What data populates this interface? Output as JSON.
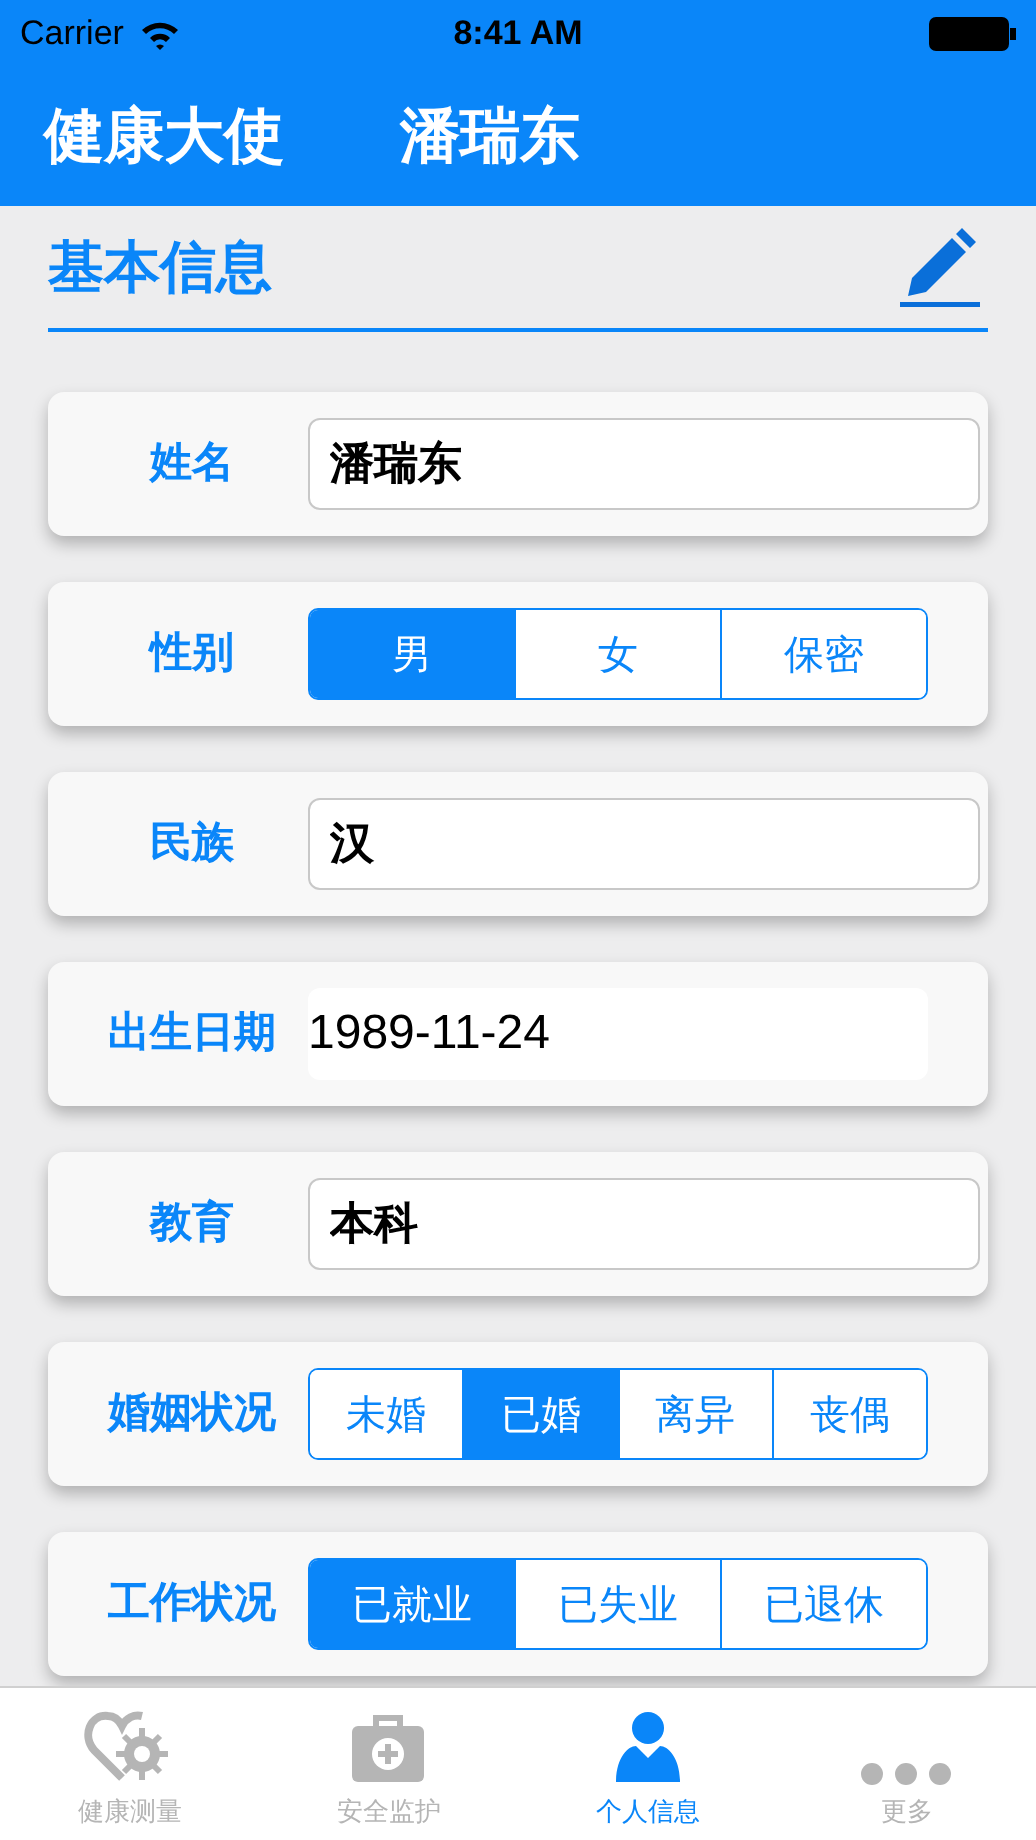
{
  "status_bar": {
    "carrier": "Carrier",
    "time": "8:41 AM"
  },
  "header": {
    "title": "健康大使",
    "name": "潘瑞东"
  },
  "section": {
    "title": "基本信息"
  },
  "fields": [
    {
      "kind": "text",
      "label": "姓名",
      "value": "潘瑞东"
    },
    {
      "kind": "segmented",
      "label": "性别",
      "options": [
        {
          "label": "男",
          "selected": true
        },
        {
          "label": "女",
          "selected": false
        },
        {
          "label": "保密",
          "selected": false
        }
      ]
    },
    {
      "kind": "text",
      "label": "民族",
      "value": "汉"
    },
    {
      "kind": "date",
      "label": "出生日期",
      "value": "1989-11-24"
    },
    {
      "kind": "text",
      "label": "教育",
      "value": "本科"
    },
    {
      "kind": "segmented",
      "label": "婚姻状况",
      "options": [
        {
          "label": "未婚",
          "selected": false
        },
        {
          "label": "已婚",
          "selected": true
        },
        {
          "label": "离异",
          "selected": false
        },
        {
          "label": "丧偶",
          "selected": false
        }
      ]
    },
    {
      "kind": "segmented",
      "label": "工作状况",
      "options": [
        {
          "label": "已就业",
          "selected": true
        },
        {
          "label": "已失业",
          "selected": false
        },
        {
          "label": "已退休",
          "selected": false
        }
      ]
    }
  ],
  "tab_bar": [
    {
      "kind": "health",
      "label": "健康测量",
      "selected": false
    },
    {
      "kind": "kit",
      "label": "安全监护",
      "selected": false
    },
    {
      "kind": "person",
      "label": "个人信息",
      "selected": true
    },
    {
      "kind": "more",
      "label": "更多",
      "selected": false
    }
  ]
}
